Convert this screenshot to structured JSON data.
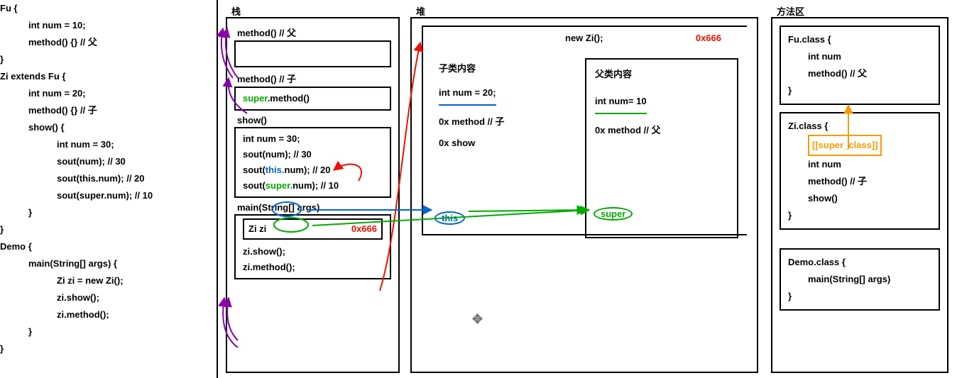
{
  "source": {
    "fu_decl": "Fu {",
    "fu_num": "int num = 10;",
    "fu_method": "method() {} // 父",
    "fu_close": "}",
    "zi_decl": "Zi extends Fu {",
    "zi_num": "int num = 20;",
    "zi_method": "method() {} // 子",
    "zi_show": "show() {",
    "zi_local": "int num = 30;",
    "zi_sout1": "sout(num); // 30",
    "zi_sout2": "sout(this.num); // 20",
    "zi_sout3": "sout(super.num); // 10",
    "zi_show_close": "}",
    "zi_close": "}",
    "demo_decl": "Demo {",
    "demo_main": "main(String[] args) {",
    "demo_l1": "Zi zi = new Zi();",
    "demo_l2": "zi.show();",
    "demo_l3": "zi.method();",
    "demo_main_close": "}",
    "demo_close": "}"
  },
  "stack": {
    "title": "栈",
    "frame_method_fu_label": "method() // 父",
    "frame_method_zi_label": "method() // 子",
    "frame_method_zi_body_pre": "super",
    "frame_method_zi_body_post": ".method()",
    "frame_show_label": "show()",
    "frame_show_l1": "int num = 30;",
    "frame_show_l2": "sout(num); // 30",
    "frame_show_l3a": "sout(",
    "frame_show_l3b": "this.",
    "frame_show_l3c": "num); // 20",
    "frame_show_l4a": "sout(",
    "frame_show_l4b": "super.",
    "frame_show_l4c": "num); // 10",
    "frame_main_label": "main(String[] args)",
    "frame_main_box_l": "Zi zi",
    "frame_main_box_r": "0x666",
    "frame_main_l2": "zi.show();",
    "frame_main_l3": "zi.method();"
  },
  "heap": {
    "title": "堆",
    "new_title": "new Zi();",
    "address": "0x666",
    "zi_label": "子类内容",
    "zi_num": "int num = 20;",
    "zi_m1": "0x method // 子",
    "zi_m2": "0x show",
    "fu_label": "父类内容",
    "fu_num": "int num= 10",
    "fu_m1": "0x method // 父",
    "this": "this",
    "super": "super"
  },
  "method_area": {
    "title": "方法区",
    "fu_decl": "Fu.class {",
    "fu_num": "int num",
    "fu_method": "method() // 父",
    "fu_close": "}",
    "zi_decl": "Zi.class {",
    "zi_super_tag": "[[super_class]]",
    "zi_num": "int num",
    "zi_method": "method() // 子",
    "zi_show": "show()",
    "zi_close": "}",
    "demo_decl": "Demo.class {",
    "demo_main": "main(String[] args)",
    "demo_close": "}"
  }
}
